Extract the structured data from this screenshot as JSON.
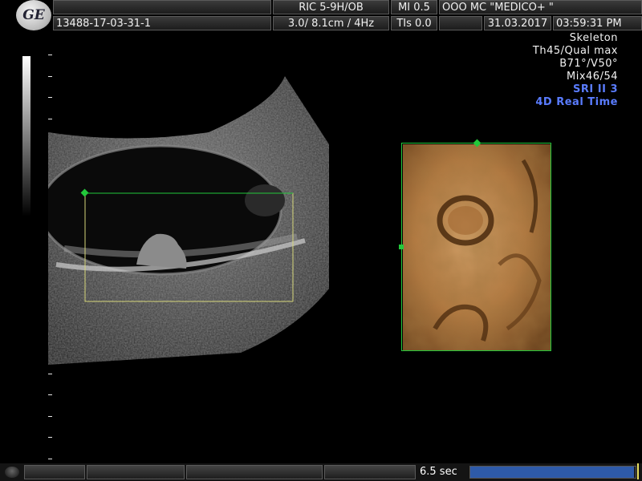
{
  "header": {
    "logo_text": "GE",
    "probe_label": "RIC 5-9H/OB",
    "mi_label": "MI  0.5",
    "institution": "OOO  MC \"MEDICO+ \"",
    "patient_id": "13488-17-03-31-1",
    "freq_label": "3.0/ 8.1cm /  4Hz",
    "tis_label": "TIs  0.0",
    "date": "31.03.2017",
    "time": "03:59:31 PM"
  },
  "info": {
    "lines": [
      "Skeleton",
      "Th45/Qual max",
      "B71°/V50°",
      "Mix46/54"
    ],
    "sri": "SRI II 3",
    "mode": "4D Real Time"
  },
  "icons": {
    "logo": "ge-logo-icon",
    "roi_handle": "diamond-handle-icon",
    "knob": "trackball-icon"
  },
  "colors": {
    "accent_blue": "#5a7cff",
    "roi_green": "#22c83a",
    "roi_yellow": "#d6d67a",
    "progress_fill": "#2e5aa8"
  },
  "bottom": {
    "acq_time": "6.5 sec",
    "progress_fraction": 0.99
  }
}
